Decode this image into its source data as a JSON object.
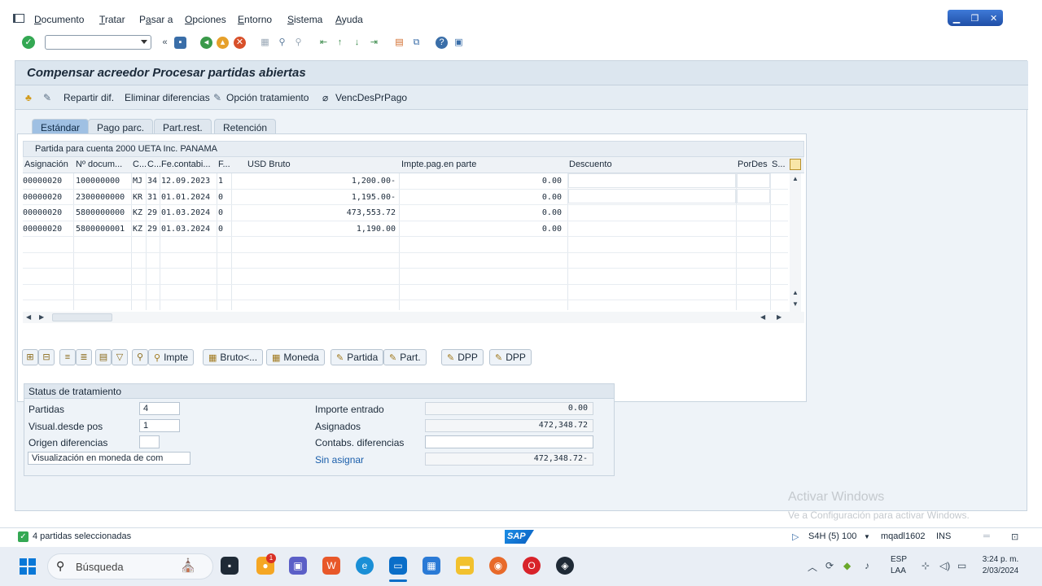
{
  "menu": [
    "Documento",
    "Tratar",
    "Pasar a",
    "Opciones",
    "Entorno",
    "Sistema",
    "Ayuda"
  ],
  "menu_underline": [
    "D",
    "T",
    "a",
    "O",
    "E",
    "S",
    "A"
  ],
  "page_title": "Compensar acreedor Procesar partidas abiertas",
  "app_toolbar": {
    "repartir": "Repartir dif.",
    "eliminar": "Eliminar diferencias",
    "opcion": "Opción tratamiento",
    "venc": "VencDesPrPago"
  },
  "tabs": [
    {
      "label": "Estándar",
      "active": true
    },
    {
      "label": "Pago parc.",
      "active": false
    },
    {
      "label": "Part.rest.",
      "active": false
    },
    {
      "label": "Retención",
      "active": false
    }
  ],
  "grid": {
    "caption": "Partida para cuenta 2000 UETA Inc. PANAMA",
    "headers": [
      "Asignación",
      "Nº docum...",
      "C...",
      "C...",
      "Fe.contabi...",
      "F...",
      "USD Bruto",
      "Impte.pag.en parte",
      "Descuento",
      "PorDes",
      "S..."
    ],
    "rows": [
      [
        "00000020",
        "100000000",
        "MJ",
        "34",
        "12.09.2023",
        "1",
        "1,200.00-",
        "0.00"
      ],
      [
        "00000020",
        "2300000000",
        "KR",
        "31",
        "01.01.2024",
        "0",
        "1,195.00-",
        "0.00"
      ],
      [
        "00000020",
        "5800000000",
        "KZ",
        "29",
        "01.03.2024",
        "0",
        "473,553.72",
        "0.00"
      ],
      [
        "00000020",
        "5800000001",
        "KZ",
        "29",
        "01.03.2024",
        "0",
        "1,190.00",
        "0.00"
      ]
    ]
  },
  "action_buttons": {
    "impte": "Impte",
    "bruto": "Bruto<...",
    "moneda": "Moneda",
    "partida": "Partida",
    "part": "Part.",
    "dpp1": "DPP",
    "dpp2": "DPP"
  },
  "status": {
    "title": "Status de tratamiento",
    "partidas_label": "Partidas",
    "partidas_value": "4",
    "visual_label": "Visual.desde pos",
    "visual_value": "1",
    "origen_label": "Origen diferencias",
    "moneda_box": "Visualización en moneda de com",
    "importe_label": "Importe entrado",
    "importe_value": "0.00",
    "asignados_label": "Asignados",
    "asignados_value": "472,348.72",
    "contabs_label": "Contabs. diferencias",
    "sin_label": "Sin asignar",
    "sin_value": "472,348.72-"
  },
  "watermark": {
    "line1": "Activar Windows",
    "line2": "Ve a Configuración para activar Windows."
  },
  "statusbar": {
    "message": "4 partidas seleccionadas",
    "sap": "SAP",
    "system": "S4H (5) 100",
    "user": "mqadl1602",
    "mode": "INS"
  },
  "taskbar": {
    "search": "Búsqueda",
    "lang1": "ESP",
    "lang2": "LAA",
    "time": "3:24 p. m.",
    "date": "2/03/2024",
    "badge": "1"
  },
  "colors": {
    "accent_blue": "#0a78d7",
    "ok_green": "#34a853",
    "tab_active": "#9fc0e3"
  }
}
